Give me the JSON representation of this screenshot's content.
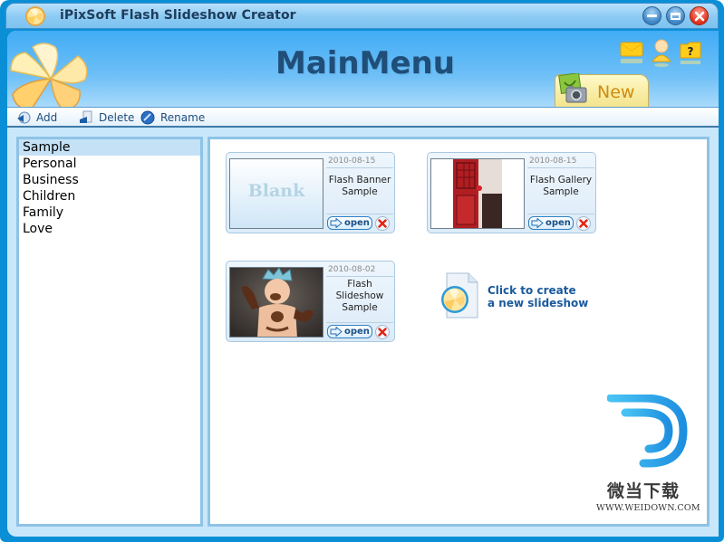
{
  "window": {
    "title": "iPixSoft Flash Slideshow Creator",
    "controls": {
      "minimize": "minimize",
      "restore": "restore",
      "close": "close"
    }
  },
  "header": {
    "title": "MainMenu",
    "icons": [
      "mail-icon",
      "user-support-icon",
      "help-icon"
    ],
    "new_tab_label": "New"
  },
  "toolbar": {
    "add_label": "Add",
    "delete_label": "Delete",
    "rename_label": "Rename"
  },
  "categories": {
    "selected": "Sample",
    "items": [
      "Sample",
      "Personal",
      "Business",
      "Children",
      "Family",
      "Love"
    ]
  },
  "templates": [
    {
      "date": "2010-08-15",
      "name": "Flash Banner Sample",
      "name_lines": [
        "Flash Banner",
        "Sample"
      ],
      "thumbnail": "Blank",
      "open_label": "open"
    },
    {
      "date": "2010-08-15",
      "name": "Flash Gallery Sample",
      "name_lines": [
        "Flash Gallery",
        "Sample"
      ],
      "thumbnail": "red-door-photo",
      "open_label": "open"
    },
    {
      "date": "2010-08-02",
      "name": "Flash Slideshow Sample",
      "name_lines": [
        "Flash",
        "Slideshow",
        "Sample"
      ],
      "thumbnail": "baby-photo",
      "open_label": "open"
    }
  ],
  "create_new": {
    "line1": "Click to create",
    "line2": "a new slideshow"
  },
  "watermark": {
    "text_cn": "微当下载",
    "url": "WWW.WEIDOWN.COM"
  }
}
